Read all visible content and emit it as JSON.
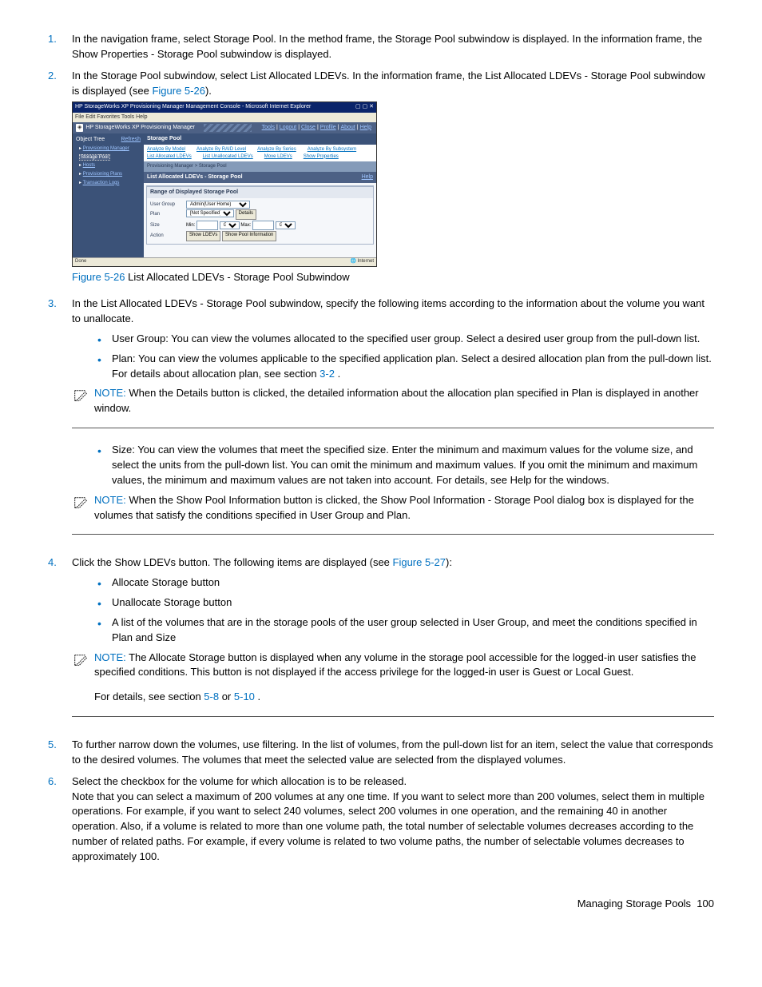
{
  "steps": {
    "s1": {
      "num": "1.",
      "text": "In the navigation frame, select Storage Pool. In the method frame, the Storage Pool subwindow is displayed. In the information frame, the Show Properties - Storage Pool subwindow is displayed."
    },
    "s2": {
      "num": "2.",
      "text_a": "In the Storage Pool subwindow, select List Allocated LDEVs. In the information frame, the List Allocated LDEVs - Storage Pool subwindow is displayed (see ",
      "link": "Figure 5-26",
      "text_b": ")."
    },
    "s3": {
      "num": "3.",
      "text": "In the List Allocated LDEVs - Storage Pool subwindow, specify the following items according to the information about the volume you want to unallocate."
    },
    "s4": {
      "num": "4.",
      "text_a": "Click the Show LDEVs button. The following items are displayed (see ",
      "link": "Figure 5-27",
      "text_b": "):"
    },
    "s5": {
      "num": "5.",
      "text": "To further narrow down the volumes, use filtering. In the list of volumes, from the pull-down list for an item, select the value that corresponds to the desired volumes. The volumes that meet the selected value are selected from the displayed volumes."
    },
    "s6": {
      "num": "6.",
      "text": "Select the checkbox for the volume for which allocation is to be released.",
      "note": "Note that you can select a maximum of 200 volumes at any one time. If you want to select more than 200 volumes, select them in multiple operations. For example, if you want to select 240 volumes, select 200 volumes in one operation, and the remaining 40 in another operation. Also, if a volume is related to more than one volume path, the total number of selectable volumes decreases according to the number of related paths. For example, if every volume is related to two volume paths, the number of selectable volumes decreases to approximately 100."
    }
  },
  "figure": {
    "title_ie": "HP StorageWorks XP Provisioning Manager Management Console - Microsoft Internet Explorer",
    "menu": "File  Edit  Favorites  Tools  Help",
    "app_title": "HP StorageWorks XP Provisioning Manager",
    "app_links": {
      "tools": "Tools",
      "logout": "Logout",
      "close": "Close",
      "profile": "Profile",
      "about": "About",
      "help": "Help"
    },
    "nav_title": "Object Tree",
    "nav_refresh": "Refresh",
    "nav": {
      "pm": "Provisioning Manager",
      "sp": "Storage Pool",
      "hosts": "Hosts",
      "plans": "Provisioning Plans",
      "logs": "Transaction Logs"
    },
    "method_title": "Storage Pool",
    "methods": {
      "m1": "Analyze By Model",
      "m2": "Analyze By RAID Level",
      "m3": "Analyze By Series",
      "m4": "Analyze By Subsystem",
      "m5": "List Allocated LDEVs",
      "m6": "List Unallocated LDEVs",
      "m7": "Move LDEVs",
      "m8": "Show Properties"
    },
    "crumb": "Provisioning Manager > Storage Pool",
    "sub_title": "List Allocated LDEVs - Storage Pool",
    "sub_help": "Help",
    "range_header": "Range of Displayed Storage Pool",
    "form": {
      "ug_label": "User Group",
      "ug_value": "Admin(User Home)",
      "plan_label": "Plan",
      "plan_value": "[Not Specified]",
      "details_btn": "Details",
      "size_label": "Size",
      "min_label": "Min:",
      "max_label": "Max:",
      "unit": "GB",
      "action_label": "Action",
      "show_ldevs_btn": "Show LDEVs",
      "show_pool_btn": "Show Pool Information"
    },
    "status_done": "Done",
    "status_internet": "Internet",
    "caption_link": "Figure 5-26",
    "caption_text": " List Allocated LDEVs - Storage Pool Subwindow"
  },
  "bullets3": {
    "b1": "User Group: You can view the volumes allocated to the specified user group. Select a desired user group from the pull-down list.",
    "b2_a": "Plan: You can view the volumes applicable to the specified application plan. Select a desired allocation plan from the pull-down list. For details about allocation plan, see section ",
    "b2_link": "3-2",
    "b2_b": " .",
    "b3": "Size: You can view the volumes that meet the specified size. Enter the minimum and maximum values for the volume size, and select the units from the pull-down list. You can omit the minimum and maximum values. If you omit the minimum and maximum values, the minimum and maximum values are not taken into account. For details, see Help for the windows."
  },
  "notes": {
    "label": "NOTE: ",
    "n1": " When the Details button is clicked, the detailed information about the allocation plan specified in Plan is displayed in another window.",
    "n2": " When the Show Pool Information button is clicked, the Show Pool Information - Storage Pool dialog box is displayed for the volumes that satisfy the conditions specified in User Group and Plan.",
    "n3": " The Allocate Storage button is displayed when any volume in the storage pool accessible for the logged-in user satisfies the specified conditions. This button is not displayed if the access privilege for the logged-in user is Guest or Local Guest.",
    "n3_extra_a": "For details, see section ",
    "n3_link1": "5-8",
    "n3_mid": "  or ",
    "n3_link2": "5-10",
    "n3_extra_b": " ."
  },
  "bullets4": {
    "b1": "Allocate Storage button",
    "b2": "Unallocate Storage button",
    "b3": "A list of the volumes that are in the storage pools of the user group selected in User Group, and meet the conditions specified in Plan and Size"
  },
  "footer": {
    "section": "Managing Storage Pools",
    "page": "100"
  }
}
